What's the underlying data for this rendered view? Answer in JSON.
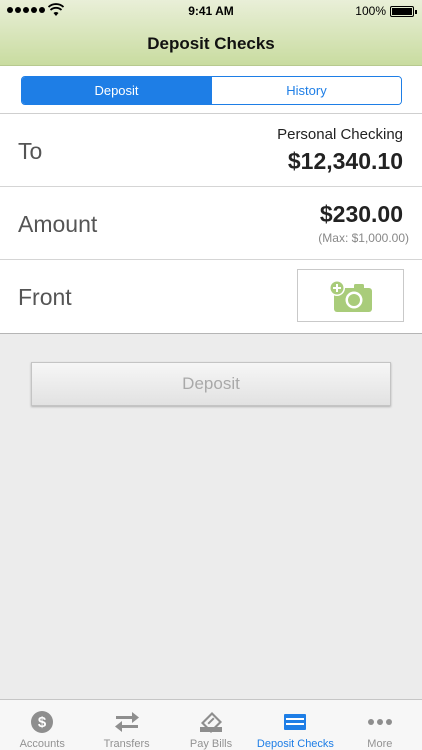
{
  "status_bar": {
    "time": "9:41 AM",
    "battery": "100%"
  },
  "nav": {
    "title": "Deposit Checks"
  },
  "segmented": {
    "items": [
      "Deposit",
      "History"
    ],
    "selected": "Deposit"
  },
  "form": {
    "to": {
      "label": "To",
      "account": "Personal Checking",
      "balance": "$12,340.10"
    },
    "amount": {
      "label": "Amount",
      "value": "$230.00",
      "max": "(Max: $1,000.00)"
    },
    "front": {
      "label": "Front",
      "icon": "add-photo-icon"
    }
  },
  "deposit_button": {
    "label": "Deposit"
  },
  "tabbar": {
    "items": [
      {
        "label": "Accounts",
        "icon": "dollar-coin-icon"
      },
      {
        "label": "Transfers",
        "icon": "transfer-arrows-icon"
      },
      {
        "label": "Pay Bills",
        "icon": "pay-bills-icon"
      },
      {
        "label": "Deposit Checks",
        "icon": "check-icon"
      },
      {
        "label": "More",
        "icon": "more-dots-icon"
      }
    ],
    "active": "Deposit Checks"
  },
  "colors": {
    "accent": "#1e7ee6",
    "header_top": "#e9efd8",
    "header_bottom": "#c9dca0",
    "camera_green": "#a9cc7a",
    "tab_inactive": "#929292"
  }
}
